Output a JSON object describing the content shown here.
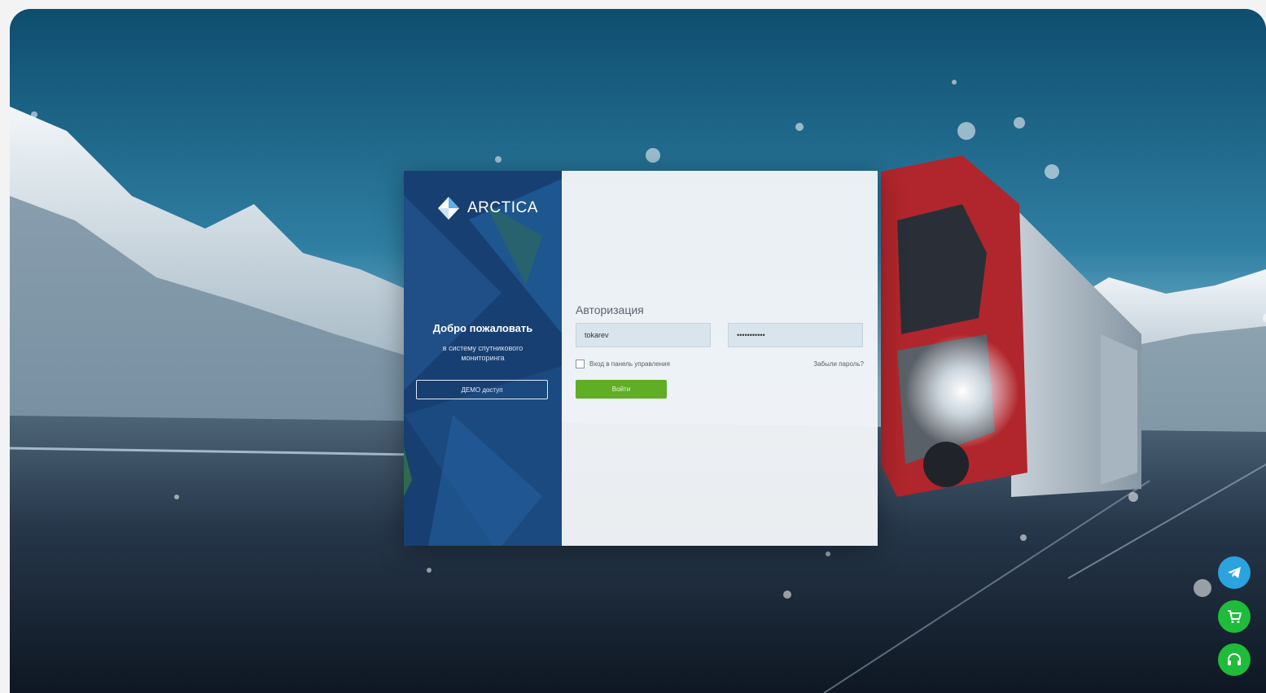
{
  "brand": {
    "name": "ARCTICA",
    "logo_icon": "diamond-logo-icon",
    "colors": {
      "primary_dark_blue": "#173f72",
      "accent_green": "#5fae25",
      "telegram_blue": "#2aa3df",
      "action_green": "#1fbb3a"
    }
  },
  "welcome_panel": {
    "title": "Добро пожаловать",
    "subtitle": "в систему спутникового мониторинга",
    "demo_button_label": "ДЕМО доступ"
  },
  "auth_form": {
    "title": "Авторизация",
    "login_value": "tokarev",
    "password_value": "•••••••••••",
    "remember_label": "Вход в панель управления",
    "remember_checked": false,
    "forgot_link": "Забыли пароль?",
    "submit_label": "Войти"
  },
  "floating_actions": [
    {
      "name": "telegram",
      "icon": "telegram-icon",
      "color": "#2aa3df"
    },
    {
      "name": "shop",
      "icon": "cart-icon",
      "color": "#1fbb3a"
    },
    {
      "name": "support",
      "icon": "headset-icon",
      "color": "#1fbb3a"
    }
  ]
}
